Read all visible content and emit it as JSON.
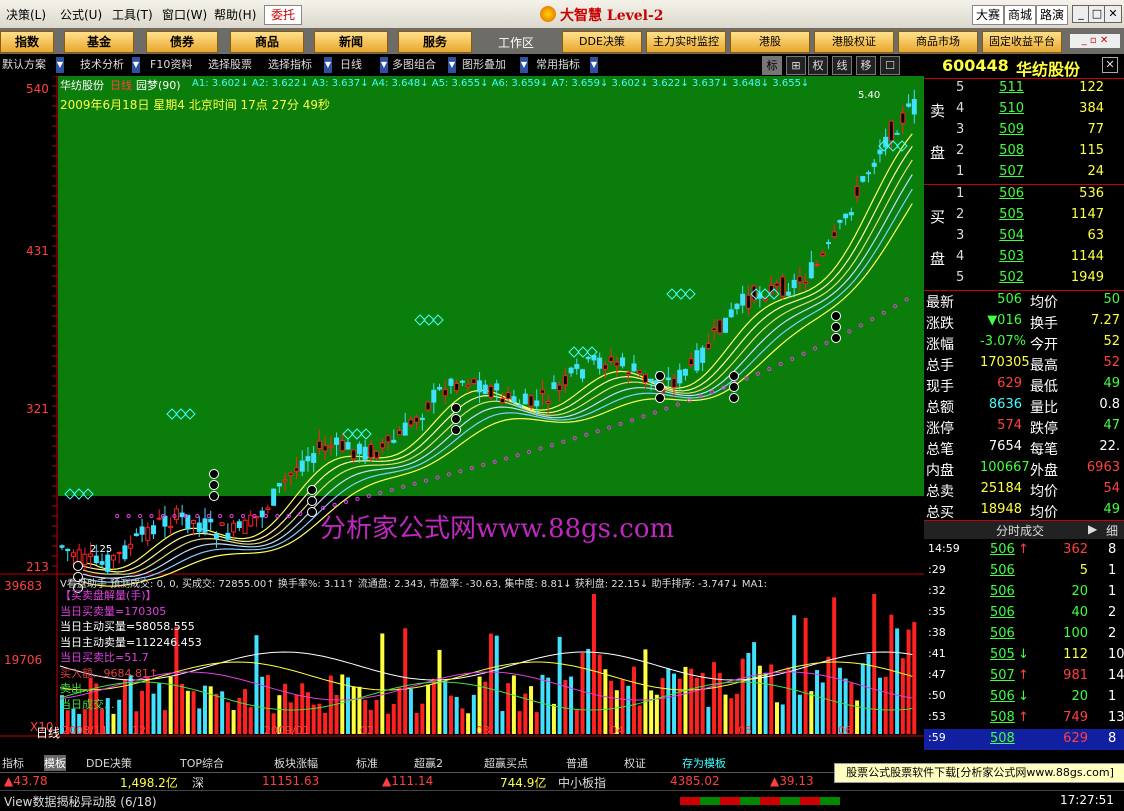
{
  "menu": [
    "决策(L)",
    "公式(U)",
    "工具(T)",
    "窗口(W)",
    "帮助(H)"
  ],
  "weituo": "委托",
  "app_title": "大智慧 Level-2",
  "right_buttons": [
    "大赛",
    "商城",
    "路演"
  ],
  "win_buttons": [
    "_",
    "□",
    "✕"
  ],
  "market_tabs": [
    "指数",
    "基金",
    "债券",
    "商品",
    "新闻",
    "服务"
  ],
  "workspace_label": "工作区",
  "feature_tabs": [
    "DDE决策",
    "主力实时监控",
    "港股",
    "港股权证",
    "商品市场",
    "固定收益平台"
  ],
  "toolbar2": {
    "items": [
      "默认方案",
      "技术分析",
      "F10资料",
      "选择股票",
      "选择指标",
      "日线",
      "多图组合",
      "图形叠加",
      "常用指标"
    ],
    "right_icons": [
      "标",
      "⊞",
      "权",
      "线",
      "移",
      "☐"
    ]
  },
  "chart_header": {
    "stock_name": "华纺股份",
    "period": "日线",
    "formula": "园梦(90)",
    "ma": "A1: 3.602↓ A2: 3.622↓ A3: 3.637↓ A4: 3.648↓ A5: 3.655↓ A6: 3.659↓ A7: 3.659↓ 3.602↓ 3.622↓ 3.637↓ 3.648↓ 3.655↓",
    "datetime": "2009年6月18日  星期4    北京时间  17点   27分   49秒",
    "high_label": "5.40",
    "low_label": "2.25",
    "watermark": "分析家公式网www.88gs.com"
  },
  "price_axis": [
    "540",
    "431",
    "321",
    "213"
  ],
  "vol_axis": [
    "39683",
    "19706",
    "X10"
  ],
  "vol_header": "V看盘助手 预测成交: 0, 0, 买成交: 72855.00↑ 换手率%: 3.11↑ 流通盘: 2.343, 市盈率: -30.63, 集中度: 8.81↓ 获利盘: 22.15↓ 助手排序: -3.747↓ MA1:",
  "vol_lines": [
    {
      "text": "【买卖盘解量(手)】",
      "color": "#e040e0"
    },
    {
      "text": "当日买卖量=170305",
      "color": "#e040e0"
    },
    {
      "text": "当日主动买量=58058.555",
      "color": "#ffffff"
    },
    {
      "text": "当日主动卖量=112246.453",
      "color": "#ffffff"
    },
    {
      "text": "当日买卖比=51.7",
      "color": "#e040e0"
    },
    {
      "text": "买入额...9684.81↑",
      "color": "#e04040"
    },
    {
      "text": "卖出...",
      "color": "#40e040"
    },
    {
      "text": "当日成交...",
      "color": "#40e040"
    }
  ],
  "date_axis": [
    "2008/11",
    "12",
    "2009/01",
    "02",
    "03",
    "04",
    "05",
    "06"
  ],
  "period_tab": "日线",
  "bottom_tabs": [
    "指标",
    "模板",
    "DDE决策",
    "TOP综合",
    "板块涨幅",
    "标准",
    "超赢2",
    "超赢买点",
    "普通",
    "权证",
    "存为模板"
  ],
  "status": {
    "i1": "▲43.78",
    "i2": "1,498.2亿",
    "i3": "深",
    "i4": "11151.63",
    "i5": "▲111.14",
    "i6": "744.9亿",
    "i7": "中小板指",
    "i8": "4385.02",
    "i9": "▲39.13"
  },
  "status2": {
    "left": "View数据揭秘异动股 (6/18)",
    "time": "17:27:51"
  },
  "ad": "股票公式股票软件下载[分析家公式网www.88gs.com]",
  "quote": {
    "code": "600448",
    "name": "华纺股份",
    "sell_label": [
      "卖",
      "盘"
    ],
    "buy_label": [
      "买",
      "盘"
    ],
    "sell": [
      {
        "lvl": "5",
        "price": "511",
        "vol": "122"
      },
      {
        "lvl": "4",
        "price": "510",
        "vol": "384"
      },
      {
        "lvl": "3",
        "price": "509",
        "vol": "77"
      },
      {
        "lvl": "2",
        "price": "508",
        "vol": "115"
      },
      {
        "lvl": "1",
        "price": "507",
        "vol": "24"
      }
    ],
    "buy": [
      {
        "lvl": "1",
        "price": "506",
        "vol": "536"
      },
      {
        "lvl": "2",
        "price": "505",
        "vol": "1147"
      },
      {
        "lvl": "3",
        "price": "504",
        "vol": "63"
      },
      {
        "lvl": "4",
        "price": "503",
        "vol": "1144"
      },
      {
        "lvl": "5",
        "price": "502",
        "vol": "1949"
      }
    ],
    "stats": [
      {
        "l1": "最新",
        "v1": "506",
        "c1": "#40ff40",
        "l2": "均价",
        "v2": "50",
        "c2": "#40ff40"
      },
      {
        "l1": "涨跌",
        "v1": "▼016",
        "c1": "#40ff40",
        "l2": "换手",
        "v2": "7.27",
        "c2": "#ffff40"
      },
      {
        "l1": "涨幅",
        "v1": "-3.07%",
        "c1": "#40ff40",
        "l2": "今开",
        "v2": "52",
        "c2": "#ffff40"
      },
      {
        "l1": "总手",
        "v1": "170305",
        "c1": "#ffff40",
        "l2": "最高",
        "v2": "52",
        "c2": "#ff4040"
      },
      {
        "l1": "现手",
        "v1": "629",
        "c1": "#ff4040",
        "l2": "最低",
        "v2": "49",
        "c2": "#40ff40"
      },
      {
        "l1": "总额",
        "v1": "8636",
        "c1": "#40ffff",
        "l2": "量比",
        "v2": "0.8",
        "c2": "#ffffff"
      },
      {
        "l1": "涨停",
        "v1": "574",
        "c1": "#ff4040",
        "l2": "跌停",
        "v2": "47",
        "c2": "#40ff40"
      },
      {
        "l1": "总笔",
        "v1": "7654",
        "c1": "#ffffff",
        "l2": "每笔",
        "v2": "22.",
        "c2": "#ffffff"
      },
      {
        "l1": "内盘",
        "v1": "100667",
        "c1": "#40ff40",
        "l2": "外盘",
        "v2": "6963",
        "c2": "#ff4040"
      },
      {
        "l1": "总卖",
        "v1": "25184",
        "c1": "#ffff40",
        "l2": "均价",
        "v2": "54",
        "c2": "#ff4040"
      },
      {
        "l1": "总买",
        "v1": "18948",
        "c1": "#ffff40",
        "l2": "均价",
        "v2": "49",
        "c2": "#40ff40"
      }
    ],
    "ticks_header": "分时成交",
    "ticks_side": "细",
    "ticks": [
      {
        "t": "14:59",
        "p": "506",
        "a": "↑",
        "v": "362",
        "n": "8",
        "vc": "#ff4040"
      },
      {
        "t": ":29",
        "p": "506",
        "a": "",
        "v": "5",
        "n": "1",
        "vc": "#ffff40"
      },
      {
        "t": ":32",
        "p": "506",
        "a": "",
        "v": "20",
        "n": "1",
        "vc": "#40ff40"
      },
      {
        "t": ":35",
        "p": "506",
        "a": "",
        "v": "40",
        "n": "2",
        "vc": "#40ff40"
      },
      {
        "t": ":38",
        "p": "506",
        "a": "",
        "v": "100",
        "n": "2",
        "vc": "#40ff40"
      },
      {
        "t": ":41",
        "p": "505",
        "a": "↓",
        "v": "112",
        "n": "10",
        "vc": "#ffff40"
      },
      {
        "t": ":47",
        "p": "507",
        "a": "↑",
        "v": "981",
        "n": "14",
        "vc": "#ff4040"
      },
      {
        "t": ":50",
        "p": "506",
        "a": "↓",
        "v": "20",
        "n": "1",
        "vc": "#40ff40"
      },
      {
        "t": ":53",
        "p": "508",
        "a": "↑",
        "v": "749",
        "n": "13",
        "vc": "#ff4040"
      },
      {
        "t": ":59",
        "p": "508",
        "a": "",
        "v": "629",
        "n": "8",
        "vc": "#ff4040"
      }
    ]
  },
  "colors": {
    "up": "#ff2020",
    "down": "#40e0ff",
    "bull_bg": "#0a8a0a",
    "axis": "#c00000"
  }
}
